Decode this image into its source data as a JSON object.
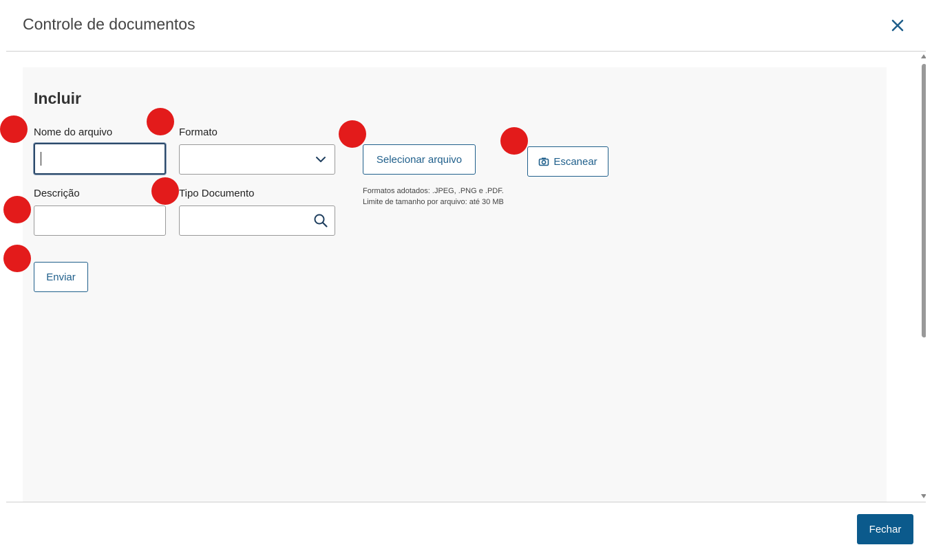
{
  "modal": {
    "title": "Controle de documentos",
    "close_icon": "close-icon"
  },
  "form": {
    "section_title": "Incluir",
    "nome_label": "Nome do arquivo",
    "nome_value": "",
    "formato_label": "Formato",
    "formato_value": "",
    "descricao_label": "Descrição",
    "descricao_value": "",
    "tipo_label": "Tipo Documento",
    "tipo_value": "",
    "select_file_label": "Selecionar arquivo",
    "scan_label": "Escanear",
    "hint_formats": "Formatos adotados: .JPEG, .PNG e .PDF.",
    "hint_size": "Limite de tamanho por arquivo: até 30 MB",
    "send_label": "Enviar"
  },
  "footer": {
    "close_label": "Fechar"
  },
  "colors": {
    "accent": "#1f5f8b",
    "primary_button": "#0b5a8c",
    "marker": "#e31b1b"
  }
}
